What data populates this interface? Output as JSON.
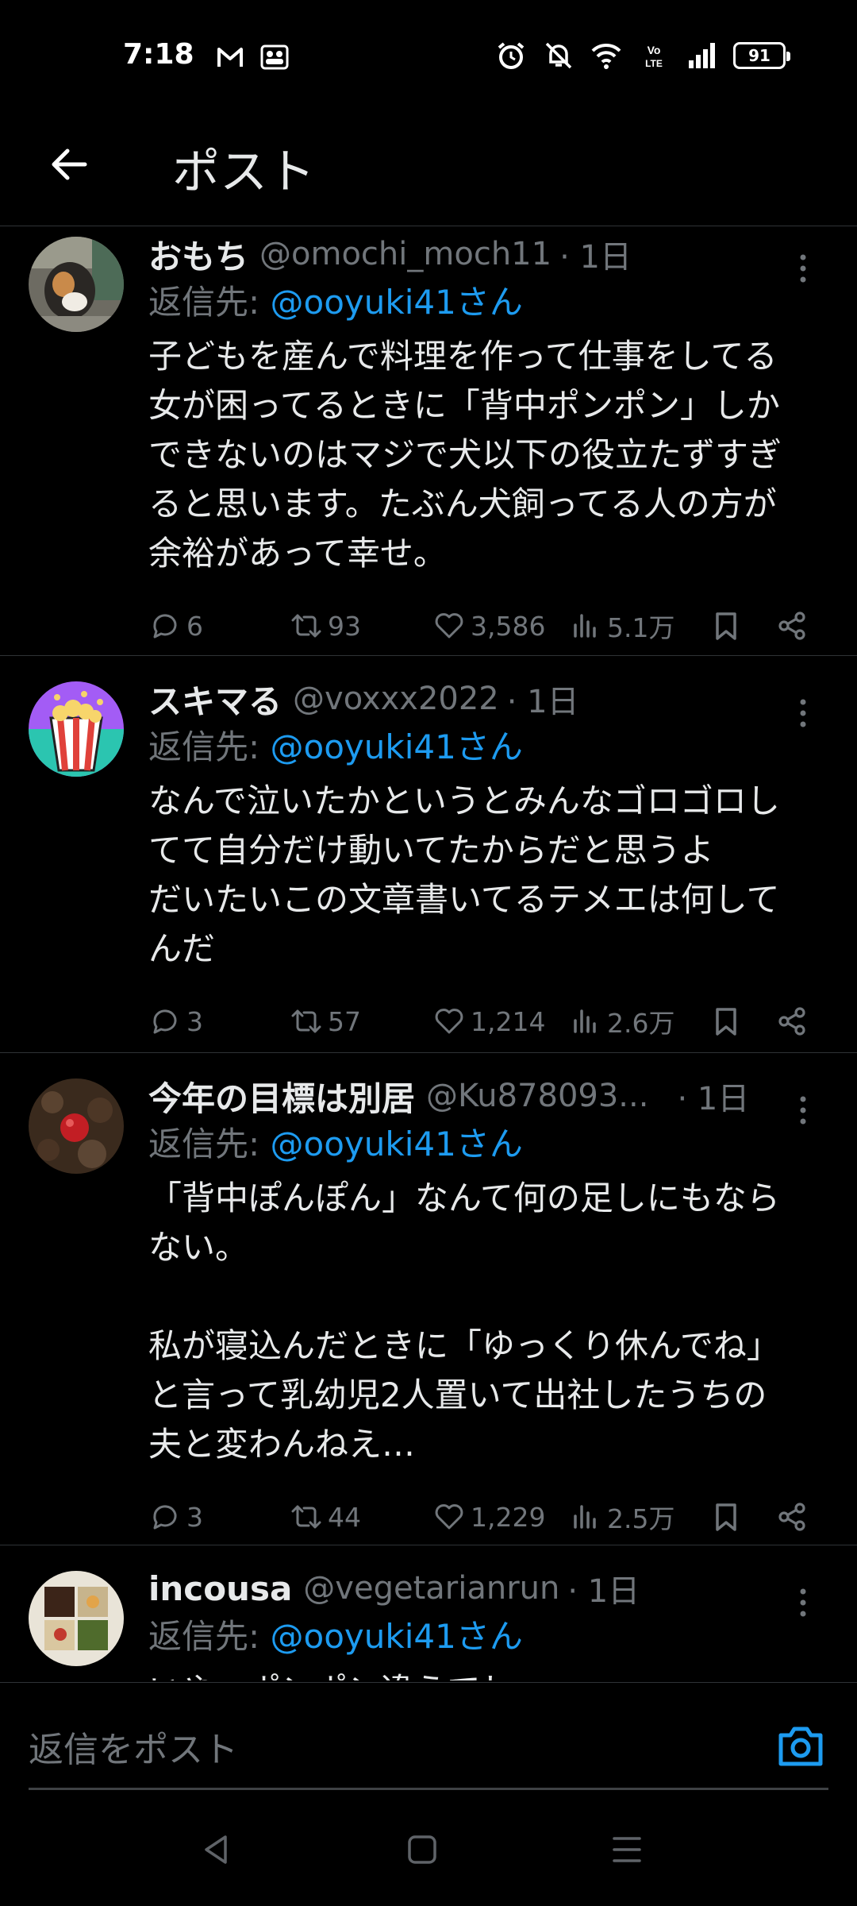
{
  "status_bar": {
    "time": "7:18",
    "left_icons": [
      "gmail-icon",
      "teams-icon"
    ],
    "right_icons": [
      "alarm-icon",
      "mute-icon",
      "wifi-icon",
      "volte-icon",
      "signal-icon"
    ],
    "battery": "91"
  },
  "header": {
    "title": "ポスト",
    "back_icon": "arrow-left-icon"
  },
  "replies": [
    {
      "name": "おもち",
      "handle": "@omochi_moch11",
      "time": "· 1日",
      "reply_label": "返信先: ",
      "reply_mention": "@ooyuki41さん",
      "text": "子どもを産んで料理を作って仕事をしてる\n女が困ってるときに「背中ポンポン」しか\nできないのはマジで犬以下の役立たずすぎ\nると思います。たぶん犬飼ってる人の方が\n余裕があって幸せ。",
      "replies": "6",
      "reposts": "93",
      "likes": "3,586",
      "views": "5.1万"
    },
    {
      "name": "スキマる",
      "handle": "@voxxx2022",
      "time": "· 1日",
      "reply_label": "返信先: ",
      "reply_mention": "@ooyuki41さん",
      "text": "なんで泣いたかというとみんなゴロゴロし\nてて自分だけ動いてたからだと思うよ\nだいたいこの文章書いてるテメエは何して\nんだ",
      "replies": "3",
      "reposts": "57",
      "likes": "1,214",
      "views": "2.6万"
    },
    {
      "name": "今年の目標は別居",
      "handle": "@Ku878093...",
      "time": "· 1日",
      "reply_label": "返信先: ",
      "reply_mention": "@ooyuki41さん",
      "text": "「背中ぽんぽん」なんて何の足しにもなら\nない。\n\n私が寝込んだときに「ゆっくり休んでね」\nと言って乳幼児2人置いて出社したうちの\n夫と変わんねえ…",
      "replies": "3",
      "reposts": "44",
      "likes": "1,229",
      "views": "2.5万"
    },
    {
      "name": "incousa",
      "handle": "@vegetarianrun",
      "time": "· 1日",
      "reply_label": "返信先: ",
      "reply_mention": "@ooyuki41さん",
      "text": "いや、ポンポン違うでしょ"
    }
  ],
  "composer": {
    "placeholder": "返信をポスト",
    "camera_icon": "camera-icon"
  },
  "nav_bar": {
    "icons": [
      "back-triangle-icon",
      "home-square-icon",
      "recents-menu-icon"
    ]
  },
  "colors": {
    "background": "#000000",
    "text": "#e7e9ea",
    "secondary": "#71767b",
    "accent": "#1d9bf0",
    "divider": "#2f3336"
  }
}
